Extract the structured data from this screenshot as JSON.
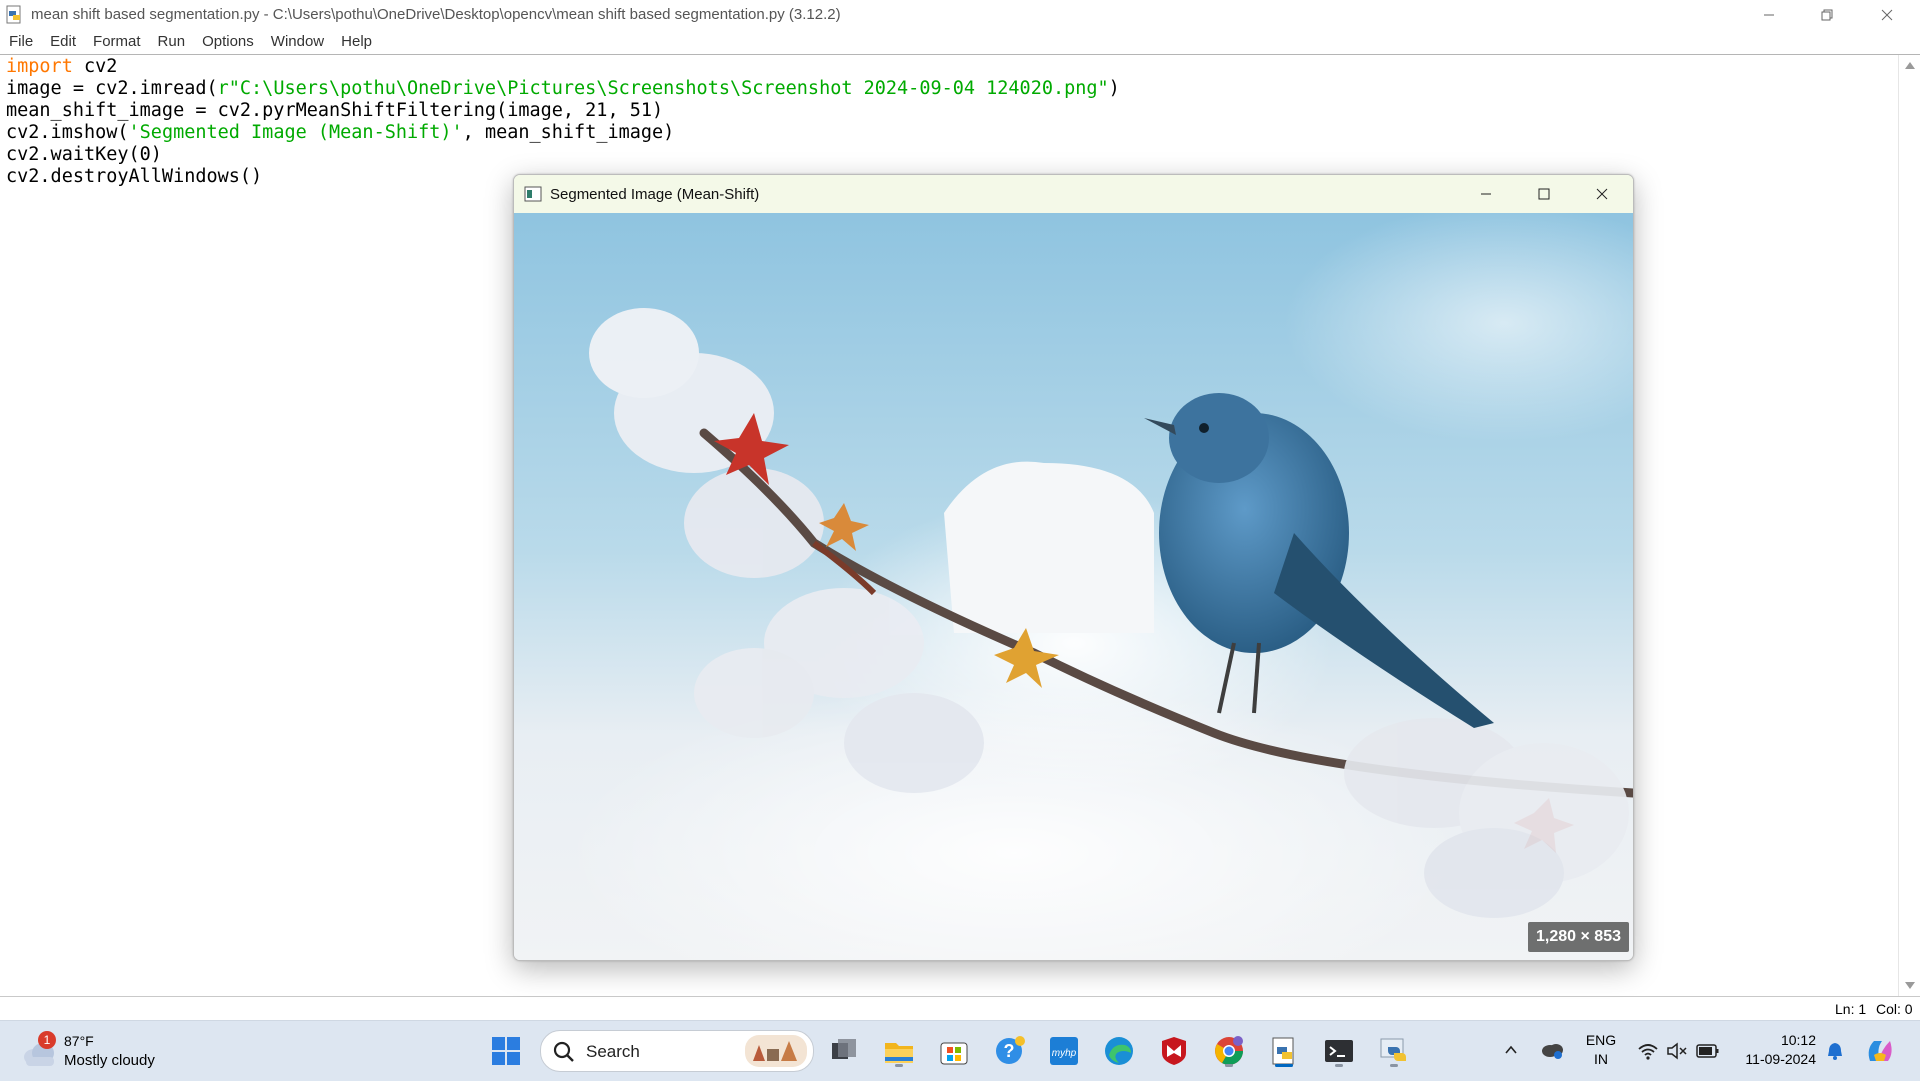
{
  "idle": {
    "title": "mean shift based segmentation.py - C:\\Users\\pothu\\OneDrive\\Desktop\\opencv\\mean shift based segmentation.py (3.12.2)",
    "menu": [
      "File",
      "Edit",
      "Format",
      "Run",
      "Options",
      "Window",
      "Help"
    ],
    "code": [
      {
        "kw": "import",
        "rest": " cv2",
        "str": "",
        "tail": ""
      },
      {
        "kw": "",
        "rest": "image = cv2.imread(",
        "str": "r\"C:\\Users\\pothu\\OneDrive\\Pictures\\Screenshots\\Screenshot 2024-09-04 124020.png\"",
        "tail": ")"
      },
      {
        "kw": "",
        "rest": "mean_shift_image = cv2.pyrMeanShiftFiltering(image, 21, 51)",
        "str": "",
        "tail": ""
      },
      {
        "kw": "",
        "rest": "cv2.imshow(",
        "str": "'Segmented Image (Mean-Shift)'",
        "tail": ", mean_shift_image)"
      },
      {
        "kw": "",
        "rest": "cv2.waitKey(0)",
        "str": "",
        "tail": ""
      },
      {
        "kw": "",
        "rest": "cv2.destroyAllWindows()",
        "str": "",
        "tail": ""
      }
    ],
    "status": {
      "line": "Ln: 1",
      "col": "Col: 0"
    }
  },
  "cv_window": {
    "title": "Segmented Image (Mean-Shift)",
    "dimensions": "1,280 × 853"
  },
  "taskbar": {
    "weather": {
      "temp": "87°F",
      "condition": "Mostly cloudy",
      "badge": "1"
    },
    "search_label": "Search",
    "apps": [
      "start-icon",
      "task-view-icon",
      "file-explorer-icon",
      "store-icon",
      "help-icon",
      "myhp-icon",
      "edge-icon",
      "mcafee-icon",
      "chrome-icon",
      "idle-editor-icon",
      "terminal-icon",
      "python-icon"
    ],
    "lang": {
      "line1": "ENG",
      "line2": "IN"
    },
    "clock": {
      "time": "10:12",
      "date": "11-09-2024"
    }
  },
  "colors": {
    "keyword": "#ff7700",
    "string": "#00aa00",
    "taskbar": "#dde6f1",
    "accent": "#0067c0"
  }
}
